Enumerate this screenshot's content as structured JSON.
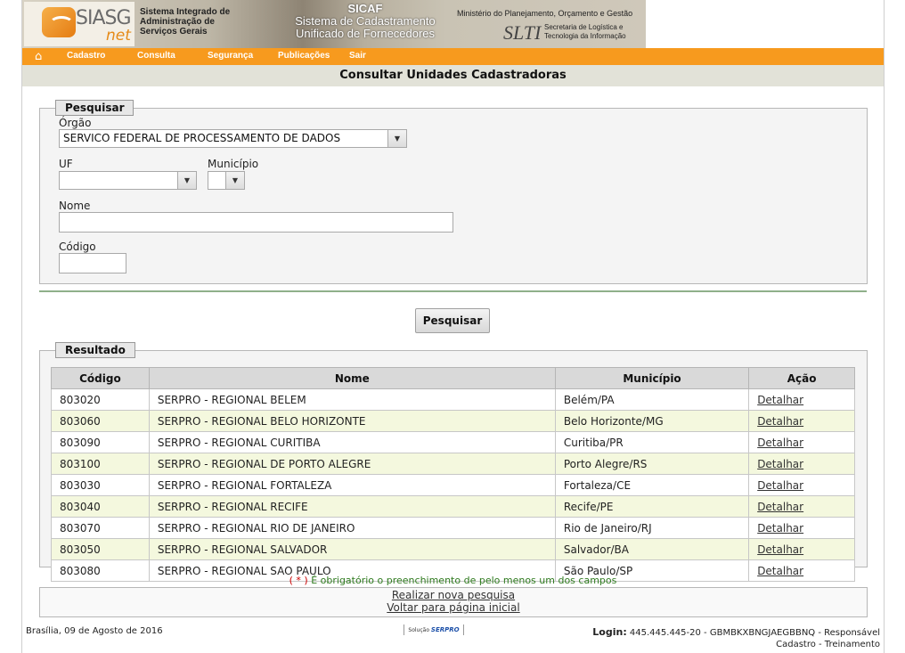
{
  "header": {
    "logo_text": "SIASG",
    "logo_sub": "net",
    "institution_line1": "Sistema Integrado de",
    "institution_line2": "Administração de",
    "institution_line3": "Serviços Gerais",
    "sicaf_title": "SICAF",
    "sicaf_line1": "Sistema de Cadastramento",
    "sicaf_line2": "Unificado de Fornecedores",
    "ministry": "Ministério do Planejamento, Orçamento e Gestão",
    "slti": "SLTI",
    "slti_line1": "Secretaria de Logística e",
    "slti_line2": "Tecnologia da Informação"
  },
  "menu": {
    "items": [
      "Cadastro",
      "Consulta",
      "Segurança",
      "Publicações",
      "Sair"
    ]
  },
  "page_title": "Consultar Unidades Cadastradoras",
  "search": {
    "legend": "Pesquisar",
    "orgao_label": "Órgão",
    "orgao_value": "SERVICO FEDERAL DE PROCESSAMENTO DE DADOS",
    "uf_label": "UF",
    "uf_value": "",
    "municipio_label": "Município",
    "municipio_value": "",
    "nome_label": "Nome",
    "nome_value": "",
    "codigo_label": "Código",
    "codigo_value": "",
    "button": "Pesquisar"
  },
  "results": {
    "legend": "Resultado",
    "columns": [
      "Código",
      "Nome",
      "Município",
      "Ação"
    ],
    "rows": [
      {
        "codigo": "803020",
        "nome": "SERPRO - REGIONAL BELEM",
        "municipio": "Belém/PA",
        "acao": "Detalhar"
      },
      {
        "codigo": "803060",
        "nome": "SERPRO - REGIONAL BELO HORIZONTE",
        "municipio": "Belo Horizonte/MG",
        "acao": "Detalhar"
      },
      {
        "codigo": "803090",
        "nome": "SERPRO - REGIONAL CURITIBA",
        "municipio": "Curitiba/PR",
        "acao": "Detalhar"
      },
      {
        "codigo": "803100",
        "nome": "SERPRO - REGIONAL DE PORTO ALEGRE",
        "municipio": "Porto Alegre/RS",
        "acao": "Detalhar"
      },
      {
        "codigo": "803030",
        "nome": "SERPRO - REGIONAL FORTALEZA",
        "municipio": "Fortaleza/CE",
        "acao": "Detalhar"
      },
      {
        "codigo": "803040",
        "nome": "SERPRO - REGIONAL RECIFE",
        "municipio": "Recife/PE",
        "acao": "Detalhar"
      },
      {
        "codigo": "803070",
        "nome": "SERPRO - REGIONAL RIO DE JANEIRO",
        "municipio": "Rio de Janeiro/RJ",
        "acao": "Detalhar"
      },
      {
        "codigo": "803050",
        "nome": "SERPRO - REGIONAL SALVADOR",
        "municipio": "Salvador/BA",
        "acao": "Detalhar"
      },
      {
        "codigo": "803080",
        "nome": "SERPRO - REGIONAL SAO PAULO",
        "municipio": "São Paulo/SP",
        "acao": "Detalhar"
      }
    ]
  },
  "note": {
    "star": "( * )",
    "text": " É obrigatório o preenchimento de pelo menos um dos campos"
  },
  "links": {
    "new_search": "Realizar nova pesquisa",
    "home": "Voltar para página inicial"
  },
  "footer": {
    "date": "Brasília, 09 de Agosto de 2016",
    "solution_label": "Solução",
    "solution_brand": "SERPRO",
    "login_label": "Login:",
    "login_value": " 445.445.445-20 - GBMBKXBNGJAEGBBNQ - Responsável",
    "login_line2": "Cadastro - Treinamento"
  },
  "colors": {
    "menu_bg": "#f79a1e",
    "title_bg": "#e2e2d8",
    "row_alt": "#f4f8de"
  }
}
